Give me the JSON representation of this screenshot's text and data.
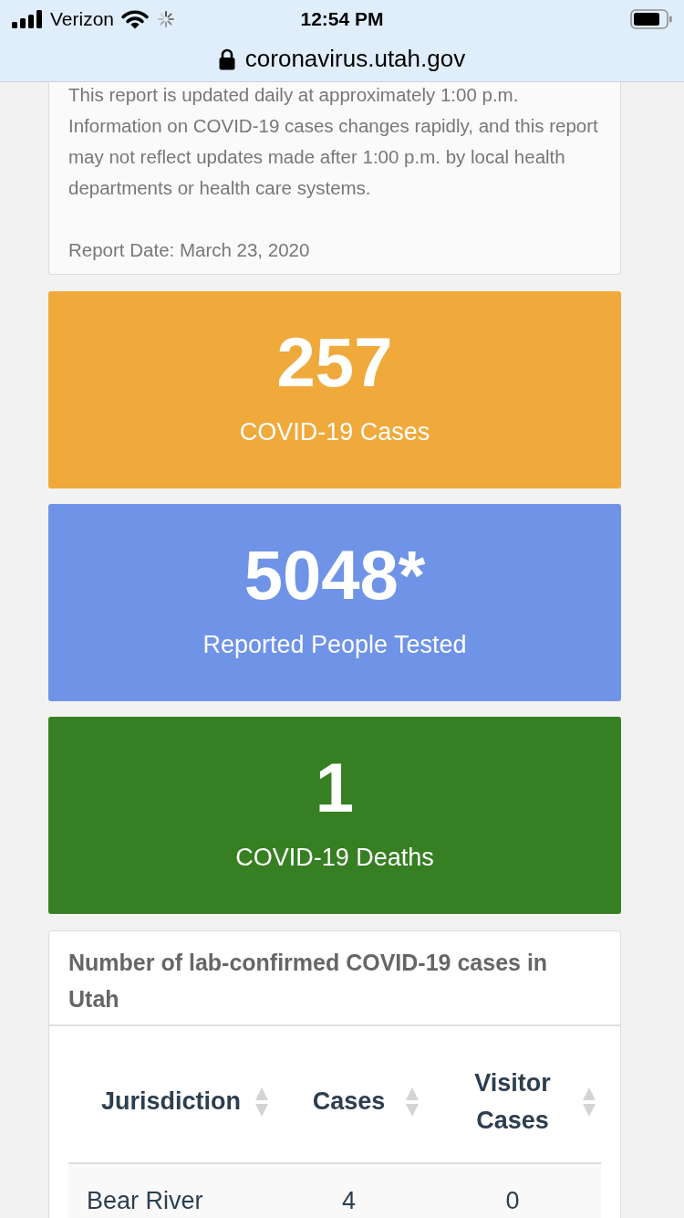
{
  "status_bar": {
    "carrier": "Verizon",
    "time": "12:54 PM"
  },
  "address_bar": {
    "url": "coronavirus.utah.gov"
  },
  "notice": {
    "text": "This report is updated daily at approximately 1:00 p.m. Information on COVID-19 cases changes rapidly, and this report may not reflect updates made after 1:00 p.m. by local health departments or health care systems.",
    "report_date": "Report Date: March 23, 2020"
  },
  "stats": [
    {
      "value": "257",
      "label": "COVID-19 Cases",
      "color": "#f0a93b"
    },
    {
      "value": "5048*",
      "label": "Reported People Tested",
      "color": "#6f93e6"
    },
    {
      "value": "1",
      "label": "COVID-19 Deaths",
      "color": "#367f22"
    }
  ],
  "cases_table": {
    "title": "Number of lab-confirmed COVID-19 cases in Utah",
    "columns": [
      {
        "label": "Jurisdiction"
      },
      {
        "label": "Cases"
      },
      {
        "label": "Visitor Cases"
      }
    ],
    "rows": [
      [
        "Bear River",
        "4",
        "0"
      ]
    ]
  }
}
